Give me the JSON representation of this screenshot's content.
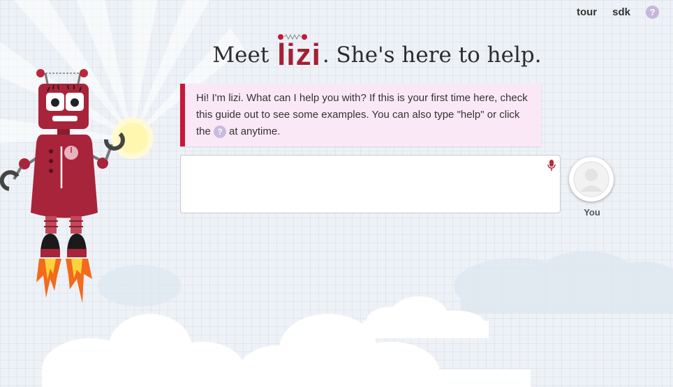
{
  "nav": {
    "tour_label": "tour",
    "sdk_label": "sdk",
    "help_glyph": "?"
  },
  "heading": {
    "prefix": "Meet",
    "brand": "lizi",
    "period": ".",
    "suffix": "She's here to help."
  },
  "bot_message": {
    "text": "Hi! I'm lizi. What can I help you with? If this is your first time here, check this guide out to see some examples. You can also type \"help\" or click the",
    "help_glyph": "?",
    "text_after": "at anytime."
  },
  "chat_input": {
    "value": "",
    "placeholder": ""
  },
  "user": {
    "label": "You"
  },
  "colors": {
    "brand": "#a41f33",
    "message_bg": "#fbe8f6",
    "message_border": "#c8173a",
    "help_icon": "#c7b7dc"
  },
  "icons": {
    "help": "question-circle-icon",
    "mic": "microphone-icon",
    "avatar": "person-silhouette-icon",
    "mascot": "robot-mascot"
  }
}
